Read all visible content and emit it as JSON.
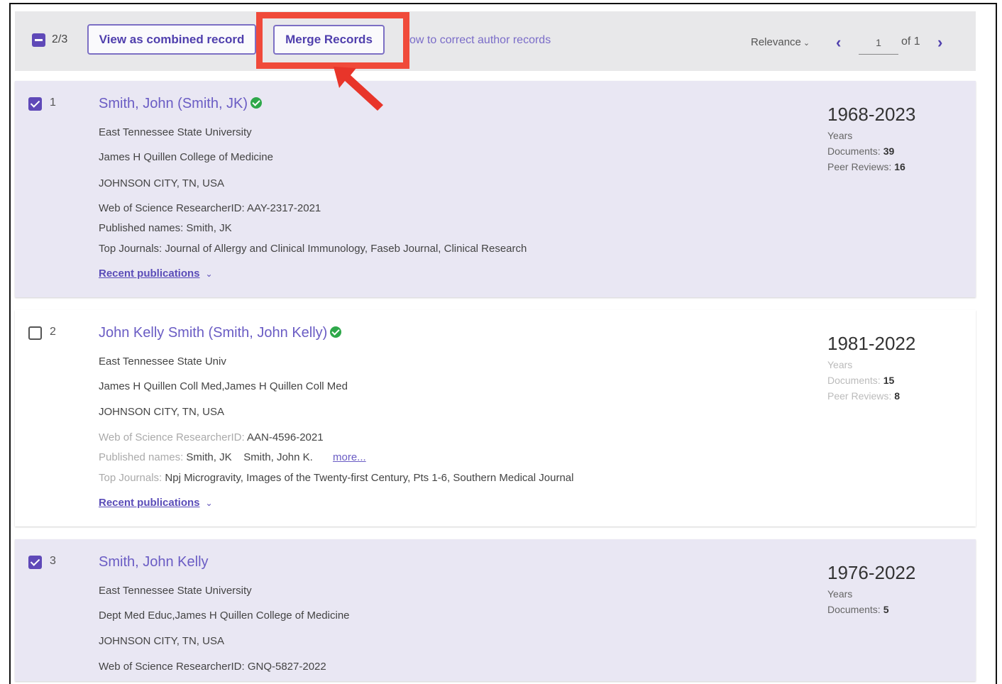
{
  "toolbar": {
    "selected_count": "2/3",
    "combined_label": "View as combined record",
    "merge_label": "Merge Records",
    "help_text": "ow to correct author records",
    "sort_label": "Relevance",
    "page_current": "1",
    "page_of": "of 1"
  },
  "colors": {
    "accent": "#5f49b8",
    "highlight": "#f04a3a",
    "selected_bg": "#e9e7f3",
    "toolbar_bg": "#e8e8ea",
    "verified": "#2ea84a"
  },
  "records": [
    {
      "num": "1",
      "checked": true,
      "name": "Smith, John (Smith, JK)",
      "verified": true,
      "affiliation": "East Tennessee State University",
      "department": "James H Quillen College of Medicine",
      "location": "JOHNSON CITY, TN, USA",
      "researcher_id_label": "Web of Science ResearcherID:",
      "researcher_id": "AAY-2317-2021",
      "published_names_label": "Published names:",
      "published_names": "Smith, JK",
      "top_journals_label": "Top Journals:",
      "top_journals": "Journal of Allergy and Clinical Immunology, Faseb Journal, Clinical Research",
      "recent_label": "Recent publications",
      "years": "1968-2023",
      "years_label": "Years",
      "documents_label": "Documents:",
      "documents": "39",
      "peer_reviews_label": "Peer Reviews:",
      "peer_reviews": "16"
    },
    {
      "num": "2",
      "checked": false,
      "name": "John Kelly Smith (Smith, John Kelly)",
      "verified": true,
      "affiliation": "East Tennessee State Univ",
      "department": "James H Quillen Coll Med,James H Quillen Coll Med",
      "location": "JOHNSON CITY, TN, USA",
      "researcher_id_label": "Web of Science ResearcherID:",
      "researcher_id": "AAN-4596-2021",
      "published_names_label": "Published names:",
      "published_names": "Smith, JK    Smith, John K.",
      "more_label": "more...",
      "top_journals_label": "Top Journals:",
      "top_journals": "Npj Microgravity, Images of the Twenty-first Century, Pts 1-6, Southern Medical Journal",
      "recent_label": "Recent publications",
      "years": "1981-2022",
      "years_label": "Years",
      "documents_label": "Documents:",
      "documents": "15",
      "peer_reviews_label": "Peer Reviews:",
      "peer_reviews": "8"
    },
    {
      "num": "3",
      "checked": true,
      "name": "Smith, John Kelly",
      "verified": false,
      "affiliation": "East Tennessee State University",
      "department": "Dept Med Educ,James H Quillen College of Medicine",
      "location": "JOHNSON CITY, TN, USA",
      "researcher_id_label": "Web of Science ResearcherID:",
      "researcher_id": "GNQ-5827-2022",
      "years": "1976-2022",
      "years_label": "Years",
      "documents_label": "Documents:",
      "documents": "5"
    }
  ]
}
